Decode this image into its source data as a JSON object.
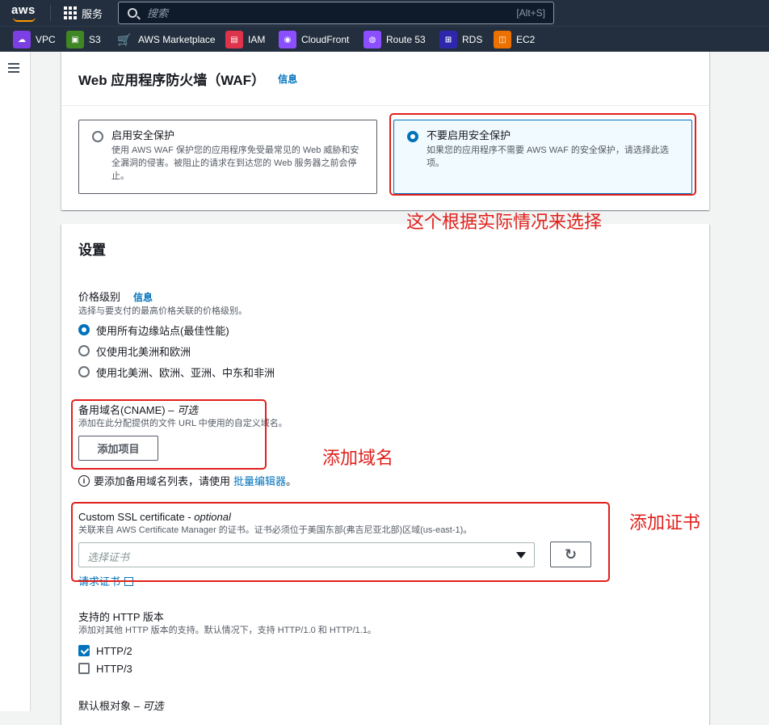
{
  "topnav": {
    "logo": "aws",
    "services_label": "服务",
    "search_placeholder": "搜索",
    "search_shortcut": "[Alt+S]"
  },
  "favorites": [
    {
      "label": "VPC",
      "icon": "vpc-icon",
      "color": "#7b3fe4"
    },
    {
      "label": "S3",
      "icon": "s3-icon",
      "color": "#3f8624"
    },
    {
      "label": "AWS Marketplace",
      "icon": "cart-icon",
      "color": "#232f3e"
    },
    {
      "label": "IAM",
      "icon": "iam-icon",
      "color": "#dd344c"
    },
    {
      "label": "CloudFront",
      "icon": "cloudfront-icon",
      "color": "#8c4fff"
    },
    {
      "label": "Route 53",
      "icon": "route53-icon",
      "color": "#8c4fff"
    },
    {
      "label": "RDS",
      "icon": "rds-icon",
      "color": "#2e27ad"
    },
    {
      "label": "EC2",
      "icon": "ec2-icon",
      "color": "#ed7100"
    }
  ],
  "waf": {
    "title": "Web 应用程序防火墙（WAF）",
    "info": "信息",
    "option_enable": {
      "title": "启用安全保护",
      "desc": "使用 AWS WAF 保护您的应用程序免受最常见的 Web 威胁和安全漏洞的侵害。被阻止的请求在到达您的 Web 服务器之前会停止。"
    },
    "option_disable": {
      "title": "不要启用安全保护",
      "desc": "如果您的应用程序不需要 AWS WAF 的安全保护，请选择此选项。"
    }
  },
  "settings": {
    "title": "设置",
    "price": {
      "label": "价格级别",
      "info": "信息",
      "desc": "选择与要支付的最高价格关联的价格级别。",
      "options": [
        "使用所有边缘站点(最佳性能)",
        "仅使用北美洲和欧洲",
        "使用北美洲、欧洲、亚洲、中东和非洲"
      ],
      "selected_index": 0
    },
    "cname": {
      "label": "备用域名(CNAME) – ",
      "optional": "可选",
      "desc": "添加在此分配提供的文件 URL 中使用的自定义域名。",
      "add_button": "添加项目",
      "note_prefix": "要添加备用域名列表，请使用",
      "note_link": "批量编辑器",
      "note_suffix": "。"
    },
    "ssl": {
      "label": "Custom SSL certificate - ",
      "optional": "optional",
      "desc": "关联来自 AWS Certificate Manager 的证书。证书必须位于美国东部(弗吉尼亚北部)区域(us-east-1)。",
      "select_placeholder": "选择证书",
      "request_link": "请求证书"
    },
    "http": {
      "label": "支持的 HTTP 版本",
      "desc": "添加对其他 HTTP 版本的支持。默认情况下，支持 HTTP/1.0 和 HTTP/1.1。",
      "options": [
        {
          "label": "HTTP/2",
          "checked": true
        },
        {
          "label": "HTTP/3",
          "checked": false
        }
      ]
    },
    "root": {
      "label": "默认根对象 – ",
      "optional": "可选"
    }
  },
  "annotations": {
    "waf_note": "这个根据实际情况来选择",
    "cname_note": "添加域名",
    "ssl_note": "添加证书",
    "color": "#e0201b"
  }
}
